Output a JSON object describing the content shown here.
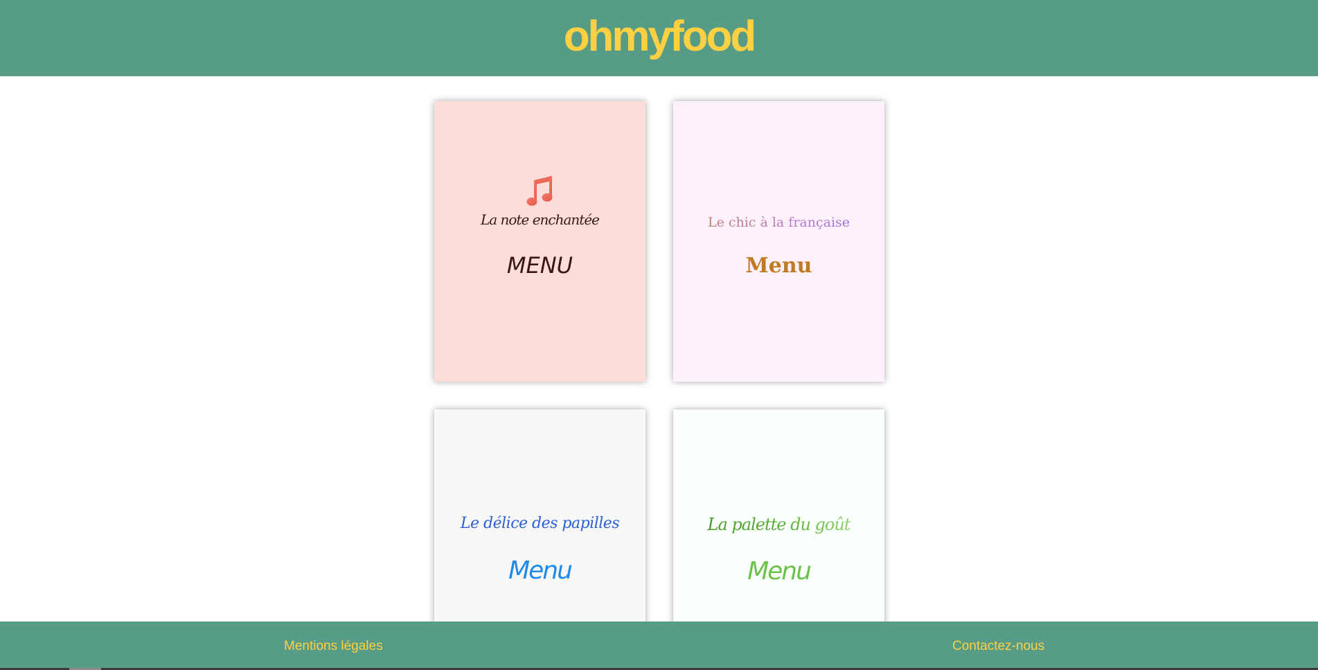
{
  "header": {
    "logo": "ohmyfood"
  },
  "colors": {
    "brand_green": "#579c86",
    "brand_yellow": "#ffd042"
  },
  "cards": [
    {
      "title": "La note enchantée",
      "menu_label": "MENU",
      "icon": "music-note-icon",
      "background": "#fbdeda"
    },
    {
      "title": "Le chic à la française",
      "menu_label": "Menu",
      "background": "#fff1fb"
    },
    {
      "title": "Le délice des papilles",
      "menu_label": "Menu",
      "background": "#f8f8f8"
    },
    {
      "title": "La palette du goût",
      "menu_label": "Menu",
      "background": "#fbfffb"
    }
  ],
  "footer": {
    "left_link": "Mentions légales",
    "right_link": "Contactez-nous"
  }
}
